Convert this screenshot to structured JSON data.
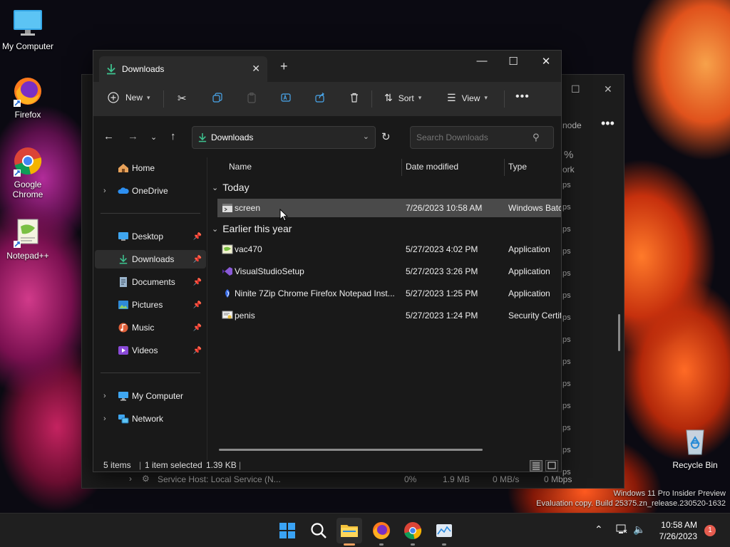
{
  "desktop": {
    "icons": [
      {
        "label": "My Computer"
      },
      {
        "label": "Firefox"
      },
      {
        "label": "Google Chrome"
      },
      {
        "label": "Notepad++"
      },
      {
        "label": "Recycle Bin"
      }
    ],
    "watermark_line1": "Windows 11 Pro Insider Preview",
    "watermark_line2": "Evaluation copy. Build 25375.zn_release.230520-1632"
  },
  "background_window": {
    "partial_texts": [
      "%",
      "ork",
      "node"
    ],
    "bottom_row": {
      "name": "Service Host: Local Service (N...",
      "cpu": "0%",
      "memory": "1.9 MB",
      "disk": "0 MB/s",
      "network": "0 Mbps"
    },
    "network_col_label": "ps"
  },
  "explorer": {
    "tab_title": "Downloads",
    "toolbar": {
      "new_label": "New",
      "sort_label": "Sort",
      "view_label": "View"
    },
    "address": "Downloads",
    "search_placeholder": "Search Downloads",
    "nav": {
      "home": "Home",
      "onedrive": "OneDrive",
      "desktop": "Desktop",
      "downloads": "Downloads",
      "documents": "Documents",
      "pictures": "Pictures",
      "music": "Music",
      "videos": "Videos",
      "my_computer": "My Computer",
      "network": "Network"
    },
    "columns": {
      "name": "Name",
      "date": "Date modified",
      "type": "Type"
    },
    "groups": {
      "today": "Today",
      "earlier": "Earlier this year"
    },
    "files": [
      {
        "name": "screen",
        "date": "7/26/2023 10:58 AM",
        "type": "Windows Batc"
      },
      {
        "name": "vac470",
        "date": "5/27/2023 4:02 PM",
        "type": "Application"
      },
      {
        "name": "VisualStudioSetup",
        "date": "5/27/2023 3:26 PM",
        "type": "Application"
      },
      {
        "name": "Ninite 7Zip Chrome Firefox Notepad Inst...",
        "date": "5/27/2023 1:25 PM",
        "type": "Application"
      },
      {
        "name": "penis",
        "date": "5/27/2023 1:24 PM",
        "type": "Security Certifi"
      }
    ],
    "status": {
      "items": "5 items",
      "selected": "1 item selected",
      "size": "1.39 KB"
    }
  },
  "taskbar": {
    "time": "10:58 AM",
    "date": "7/26/2023",
    "notification_count": "1"
  },
  "colors": {
    "accent_green": "#3ec28f",
    "selection": "#4a4a4a",
    "window_bg": "#191919"
  }
}
